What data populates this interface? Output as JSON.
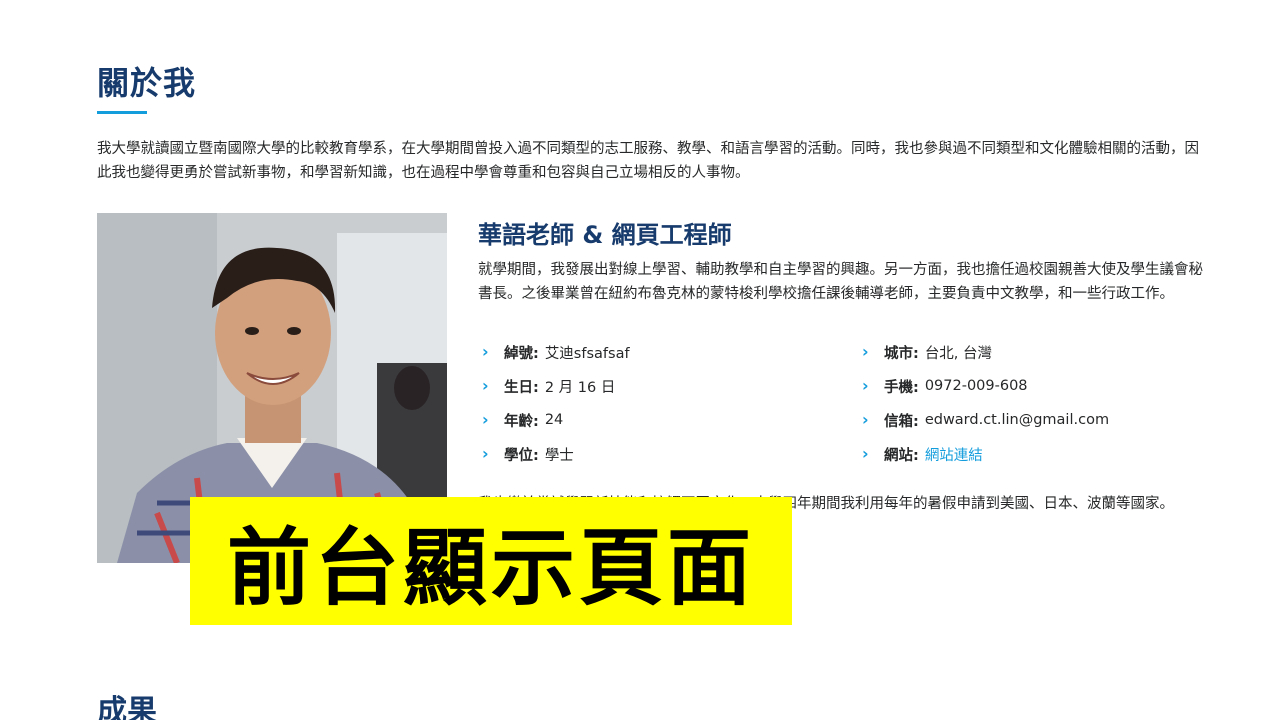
{
  "about": {
    "title": "關於我",
    "intro": "我大學就讀國立暨南國際大學的比較教育學系，在大學期間曾投入過不同類型的志工服務、教學、和語言學習的活動。同時，我也參與過不同類型和文化體驗相關的活動，因此我也變得更勇於嘗試新事物，和學習新知識，也在過程中學會尊重和包容與自己立場相反的人事物。",
    "role_title": "華語老師 & 網頁工程師",
    "role_desc": "就學期間，我發展出對線上學習、輔助教學和自主學習的興趣。另一方面，我也擔任過校園親善大使及學生議會秘書長。之後畢業曾在紐約布魯克林的蒙特梭利學校擔任課後輔導老師，主要負責中文教學，和一些行政工作。",
    "facts_left": [
      {
        "label": "綽號:",
        "value": "艾迪sfsafsaf"
      },
      {
        "label": "生日:",
        "value": "2 月 16 日"
      },
      {
        "label": "年齡:",
        "value": "24"
      },
      {
        "label": "學位:",
        "value": "學士"
      }
    ],
    "facts_right": [
      {
        "label": "城市:",
        "value": "台北, 台灣"
      },
      {
        "label": "手機:",
        "value": "0972-009-608"
      },
      {
        "label": "信箱:",
        "value": "edward.ct.lin@gmail.com"
      },
      {
        "label": "網站:",
        "value": "網站連結"
      }
    ],
    "outro": "我也樂於嘗試學習新技能和接觸不同文化。大學四年期間我利用每年的暑假申請到美國、日本、波蘭等國家。"
  },
  "overlay_banner": "前台顯示頁面",
  "next_section_title": "成果",
  "colors": {
    "heading": "#173b6c",
    "accent": "#149ddd",
    "text": "#272829",
    "banner_bg": "#ffff00"
  },
  "icons": {
    "fact_bullet": "chevron-right-icon"
  }
}
